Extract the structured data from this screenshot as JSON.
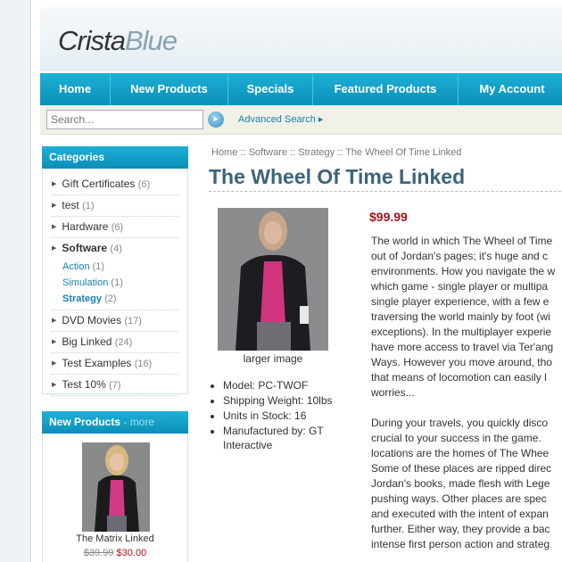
{
  "logo": {
    "part1": "Crista",
    "part2": "Blue"
  },
  "nav": [
    "Home",
    "New Products",
    "Specials",
    "Featured Products",
    "My Account"
  ],
  "search": {
    "placeholder": "Search...",
    "advanced_label": "Advanced Search"
  },
  "categories": {
    "title": "Categories",
    "items": [
      {
        "name": "Gift Certificates",
        "count": "(6)"
      },
      {
        "name": "test",
        "count": "(1)"
      },
      {
        "name": "Hardware",
        "count": "(6)"
      },
      {
        "name": "Software",
        "count": "(4)"
      },
      {
        "name": "DVD Movies",
        "count": "(17)"
      },
      {
        "name": "Big Linked",
        "count": "(24)"
      },
      {
        "name": "Test Examples",
        "count": "(16)"
      },
      {
        "name": "Test 10%",
        "count": "(7)"
      }
    ],
    "sub_items": [
      {
        "name": "Action",
        "count": "(1)"
      },
      {
        "name": "Simulation",
        "count": "(1)"
      },
      {
        "name": "Strategy",
        "count": "(2)"
      }
    ]
  },
  "new_products": {
    "title": "New Products",
    "more": "- more",
    "product_name": "The Matrix Linked",
    "old_price": "$39.99",
    "new_price": "$30.00"
  },
  "breadcrumb": "Home :: Software :: Strategy :: The Wheel Of Time Linked",
  "product": {
    "title": "The Wheel Of Time Linked",
    "price": "$99.99",
    "larger_image": "larger image",
    "details": [
      "Model: PC-TWOF",
      "Shipping Weight: 10lbs",
      "Units in Stock: 16",
      "Manufactured by: GT Interactive"
    ],
    "description_1": "The world in which The Wheel of Time\nout of Jordan's pages; it's huge and c\nenvironments. How you navigate the w\nwhich game - single player or multipa\nsingle player experience, with a few e\ntraversing the world mainly by foot (wi\nexceptions). In the multiplayer experie\nhave more access to travel via Ter'ang\nWays. However you move around, tho\nthat means of locomotion can easily l\nworries...",
    "description_2": "During your travels, you quickly disco\ncrucial to your success in the game.\nlocations are the homes of The Whee\nSome of these places are ripped direc\nJordan's books, made flesh with Lege\npushing ways. Other places are spec\nand executed with the intent of expan\nfurther. Either way, they provide a bac\nintense first person action and strateg"
  }
}
